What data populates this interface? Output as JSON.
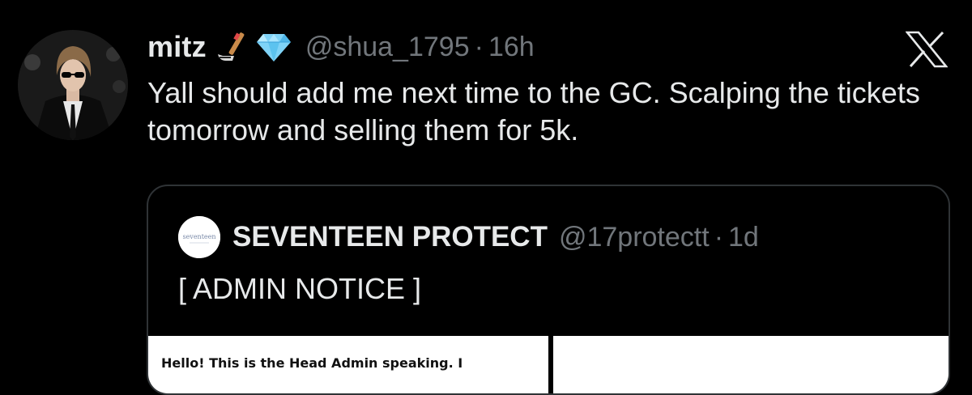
{
  "tweet": {
    "display_name": "mitz",
    "badges": [
      "hockey-stick-emoji",
      "gem-emoji"
    ],
    "handle": "@shua_1795",
    "separator": "·",
    "timestamp": "16h",
    "text": "Yall should add me next time to the GC. Scalping the tickets tomorrow and selling them for 5k.",
    "avatar_icon": "profile-photo"
  },
  "branding": {
    "logo_icon": "x-logo-icon"
  },
  "quote": {
    "display_name": "SEVENTEEN PROTECT",
    "handle": "@17protectt",
    "separator": "·",
    "timestamp": "1d",
    "text": "[ ADMIN NOTICE ]",
    "avatar_label": "seventeen",
    "media": {
      "left_text": "Hello! This is the Head Admin speaking. I"
    }
  },
  "colors": {
    "background": "#000000",
    "primary_text": "#e7e9ea",
    "secondary_text": "#71767b",
    "border": "#2f3336"
  }
}
